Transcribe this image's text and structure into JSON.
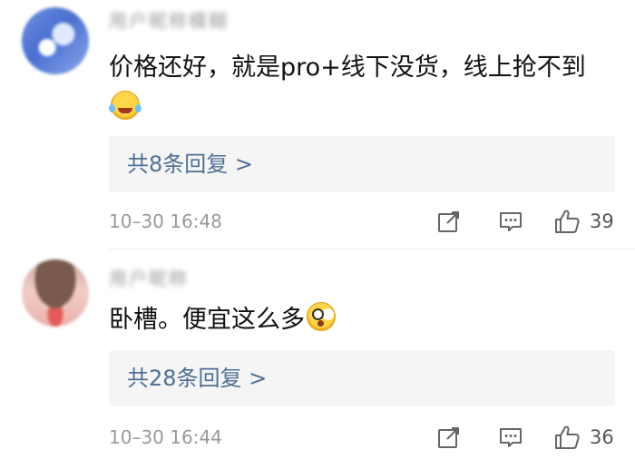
{
  "comments": [
    {
      "username": "用户昵称模糊",
      "text": "价格还好，就是pro+线下没货，线上抢不到",
      "emoji": "laughing-tears-emoji",
      "replies_label": "共8条回复 >",
      "time": "10–30 16:48",
      "likes": "39"
    },
    {
      "username": "用户昵称",
      "text": "卧槽。便宜这么多",
      "emoji": "shocked-face-emoji",
      "replies_label": "共28条回复 >",
      "time": "10–30 16:44",
      "likes": "36"
    }
  ],
  "colors": {
    "link": "#4f6f95",
    "meta": "#999999",
    "reply_box": "#f5f5f5"
  },
  "icons": [
    "share-icon",
    "comment-icon",
    "like-icon"
  ]
}
